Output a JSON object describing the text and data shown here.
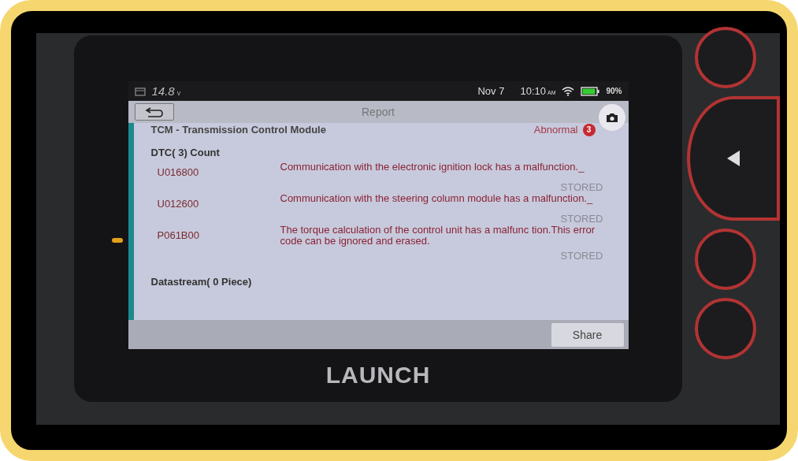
{
  "status_bar": {
    "voltage": "14.8",
    "voltage_unit": "v",
    "date": "Nov 7",
    "time": "10:10",
    "ampm": "AM",
    "battery": "90%"
  },
  "dialog": {
    "title": "Report",
    "module": "TCM - Transmission Control Module",
    "status": "Abnormal",
    "status_count": "3",
    "dtc_heading": "DTC( 3) Count",
    "dtcs": [
      {
        "code": "U016800",
        "description": "Communication with the electronic ignition lock has a malfunction._",
        "state": "STORED"
      },
      {
        "code": "U012600",
        "description": "Communication with the steering column module has a malfunction._",
        "state": "STORED"
      },
      {
        "code": "P061B00",
        "description": "The torque calculation of the control unit has a malfunc tion.This error code can be ignored and erased.",
        "state": "STORED"
      }
    ],
    "datastream_heading": "Datastream( 0 Piece)",
    "share_button": "Share"
  },
  "device": {
    "brand": "LAUNCH"
  }
}
